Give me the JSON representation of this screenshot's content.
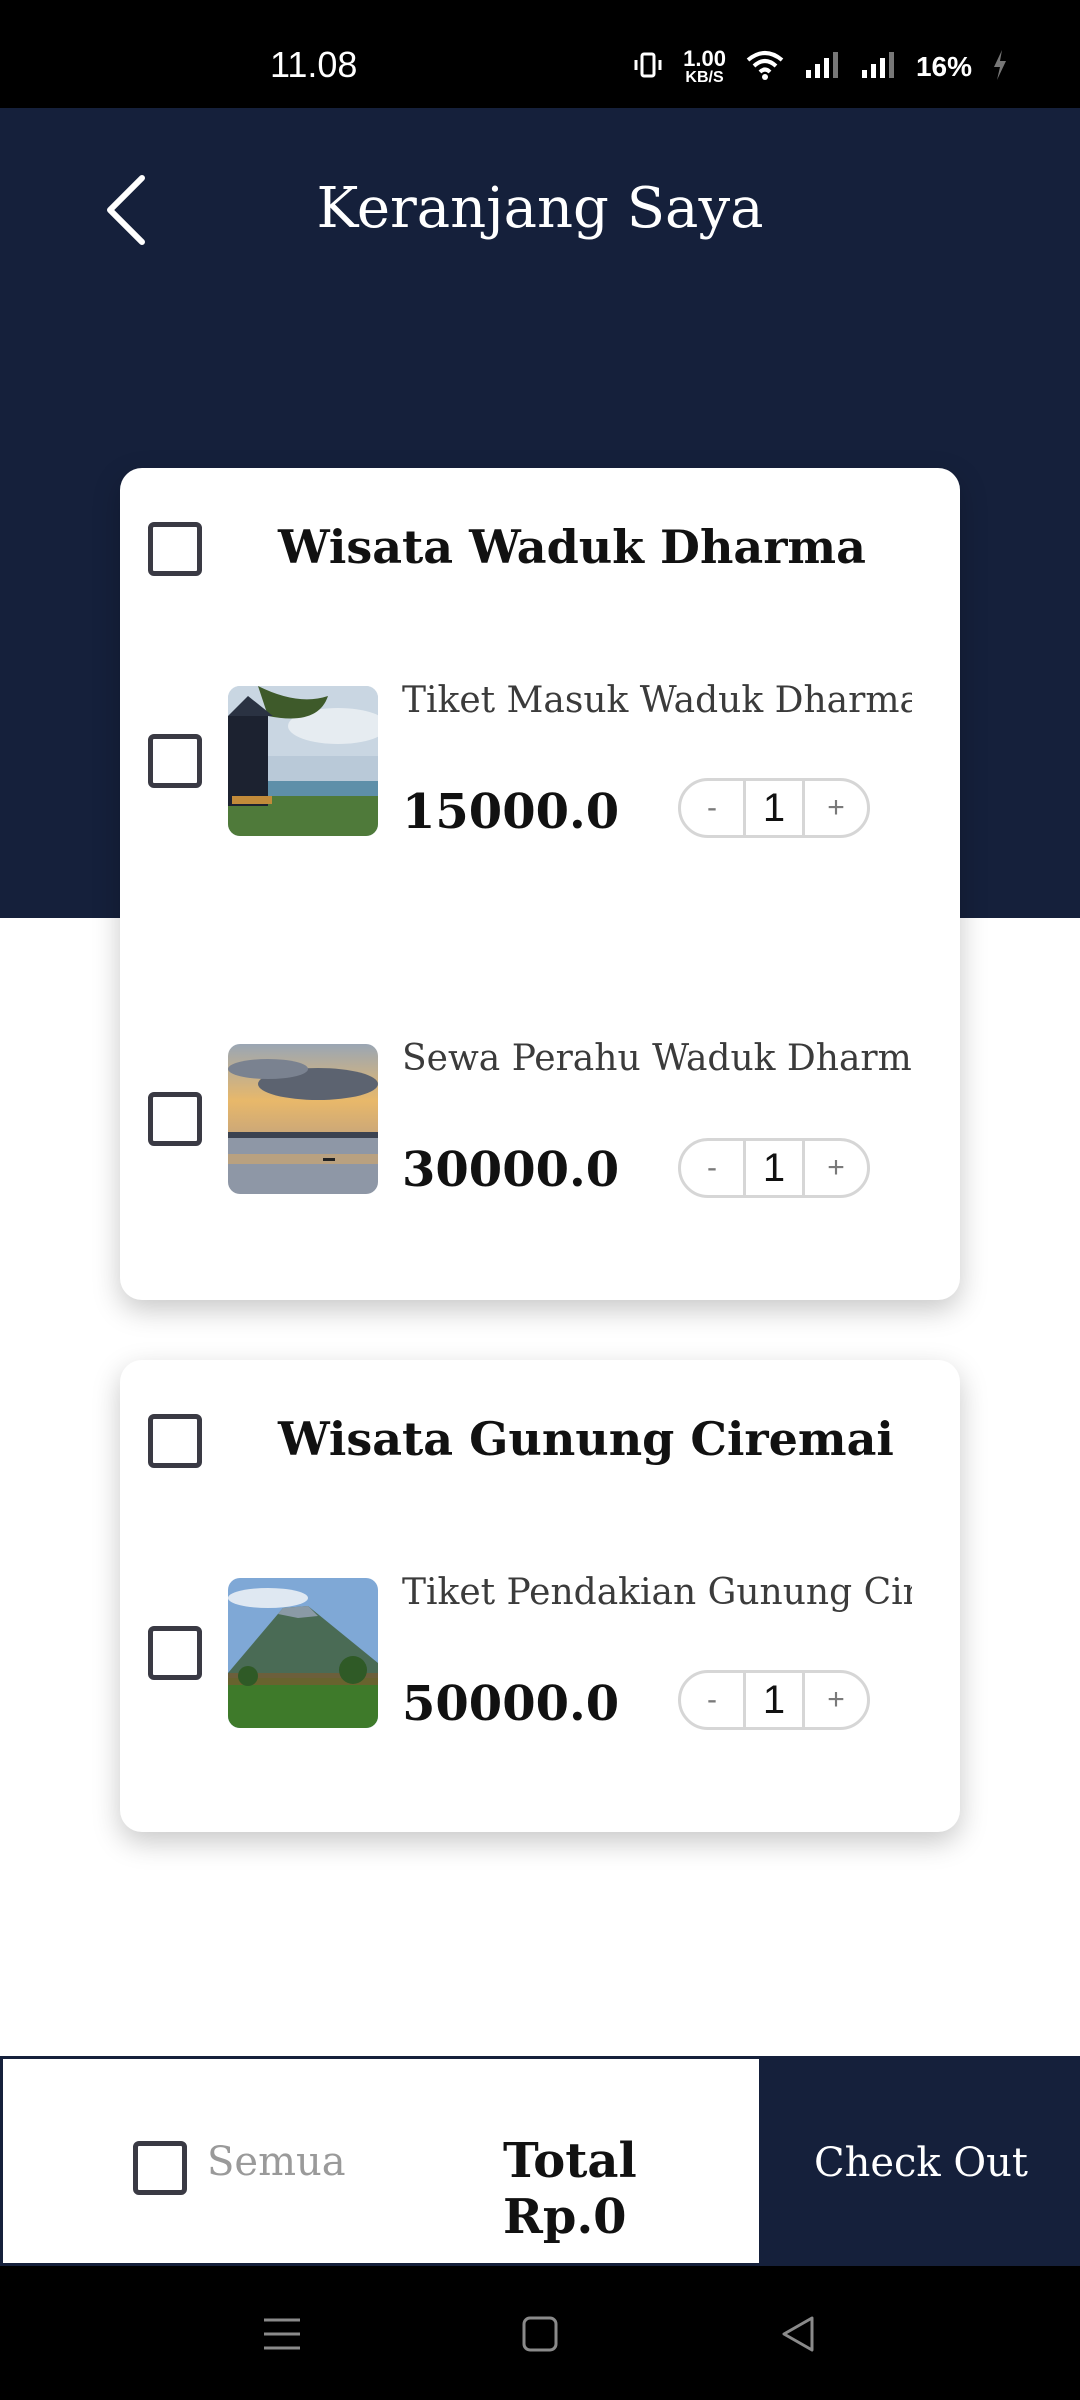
{
  "status_bar": {
    "time": "11.08",
    "net_speed_value": "1.00",
    "net_speed_unit": "KB/S",
    "battery": "16%"
  },
  "header": {
    "title": "Keranjang Saya"
  },
  "groups": [
    {
      "title": "Wisata Waduk Dharma",
      "items": [
        {
          "name": "Tiket Masuk Waduk Dharma",
          "price": "15000.0",
          "qty": "1"
        },
        {
          "name": "Sewa Perahu Waduk Dharma",
          "price": "30000.0",
          "qty": "1"
        }
      ]
    },
    {
      "title": "Wisata Gunung Ciremai",
      "items": [
        {
          "name": "Tiket Pendakian Gunung Ciremai",
          "price": "50000.0",
          "qty": "1"
        }
      ]
    }
  ],
  "stepper": {
    "minus": "-",
    "plus": "+"
  },
  "footer": {
    "select_all_label": "Semua",
    "total_label": "Total Rp.0",
    "checkout_label": "Check Out"
  },
  "colors": {
    "primary": "#15203b",
    "background": "#ffffff"
  }
}
